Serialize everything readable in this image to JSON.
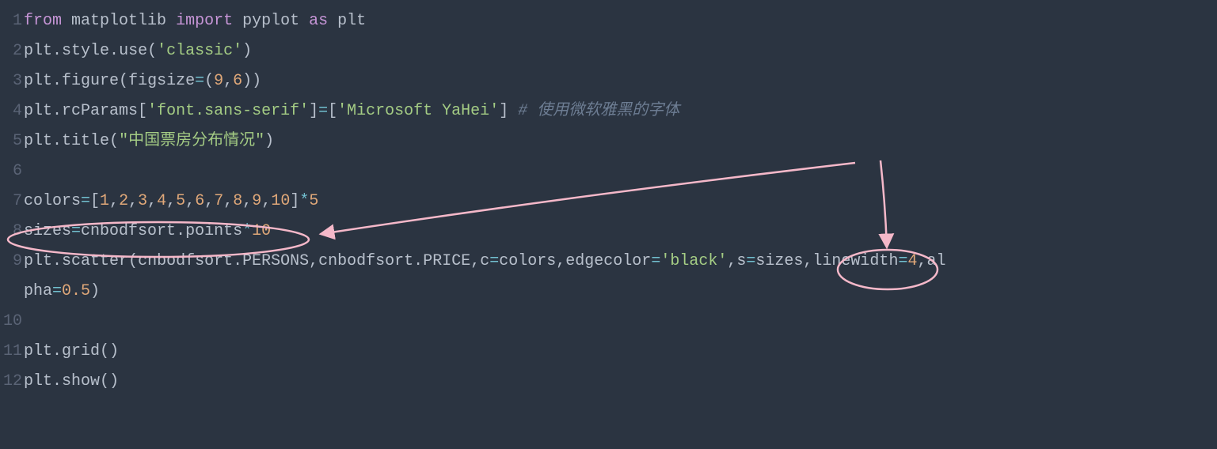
{
  "code": {
    "line1": {
      "kw_from": "from",
      "id_matplotlib": "matplotlib",
      "kw_import": "import",
      "id_pyplot": "pyplot",
      "kw_as": "as",
      "id_plt": "plt"
    },
    "line2": {
      "id_plt": "plt",
      "dot1": ".",
      "id_style": "style",
      "dot2": ".",
      "id_use": "use",
      "open": "(",
      "str_classic": "'classic'",
      "close": ")"
    },
    "line3": {
      "id_plt": "plt",
      "dot": ".",
      "id_figure": "figure",
      "open": "(",
      "id_figsize": "figsize",
      "eq": "=",
      "open2": "(",
      "num9": "9",
      "comma": ",",
      "num6": "6",
      "close2": ")",
      "close": ")"
    },
    "line4": {
      "id_plt": "plt",
      "dot": ".",
      "id_rcParams": "rcParams",
      "bopen": "[",
      "str_font": "'font.sans-serif'",
      "bclose": "]",
      "eq": "=",
      "bopen2": "[",
      "str_yahei": "'Microsoft YaHei'",
      "bclose2": "]",
      "sp": " ",
      "comment": "# 使用微软雅黑的字体"
    },
    "line5": {
      "id_plt": "plt",
      "dot": ".",
      "id_title": "title",
      "open": "(",
      "str_title": "\"中国票房分布情况\"",
      "close": ")"
    },
    "line7": {
      "id_colors": "colors",
      "eq": "=",
      "bopen": "[",
      "n1": "1",
      "c1": ",",
      "n2": "2",
      "c2": ",",
      "n3": "3",
      "c3": ",",
      "n4": "4",
      "c4": ",",
      "n5": "5",
      "c5": ",",
      "n6": "6",
      "c6": ",",
      "n7": "7",
      "c7": ",",
      "n8": "8",
      "c8": ",",
      "n9": "9",
      "c9": ",",
      "n10": "10",
      "bclose": "]",
      "mul": "*",
      "n5b": "5"
    },
    "line8": {
      "id_sizes": "sizes",
      "eq": "=",
      "id_cnbodfsort": "cnbodfsort",
      "dot": ".",
      "id_points": "points",
      "mul": "*",
      "n10": "10"
    },
    "line9": {
      "id_plt": "plt",
      "dot": ".",
      "id_scatter": "scatter",
      "open": "(",
      "id_cnbodfsort1": "cnbodfsort",
      "dot1": ".",
      "id_PERSONS": "PERSONS",
      "comma1": ",",
      "id_cnbodfsort2": "cnbodfsort",
      "dot2": ".",
      "id_PRICE": "PRICE",
      "comma2": ",",
      "id_c": "c",
      "eq1": "=",
      "id_colors": "colors",
      "comma3": ",",
      "id_edgecolor": "edgecolor",
      "eq2": "=",
      "str_black": "'black'",
      "comma4": ",",
      "id_s": "s",
      "eq3": "=",
      "id_sizes": "sizes",
      "comma5": ",",
      "id_linewidth": "linewidth",
      "eq4": "=",
      "n4": "4",
      "comma6": ",",
      "id_al": "al"
    },
    "line9b": {
      "id_pha": "pha",
      "eq": "=",
      "n05": "0.5",
      "close": ")"
    },
    "line11": {
      "id_plt": "plt",
      "dot": ".",
      "id_grid": "grid",
      "open": "(",
      "close": ")"
    },
    "line12": {
      "id_plt": "plt",
      "dot": ".",
      "id_show": "show",
      "open": "(",
      "close": ")"
    }
  },
  "annotations": {
    "ellipse_line8": {
      "color": "#f5b8c9"
    },
    "ellipse_sizes": {
      "color": "#f5b8c9"
    },
    "arrow_color": "#f5b8c9"
  },
  "linenos": {
    "l1": "1",
    "l2": "2",
    "l3": "3",
    "l4": "4",
    "l5": "5",
    "l6": "6",
    "l7": "7",
    "l8": "8",
    "l9": "9",
    "l10": "10",
    "l11": "11",
    "l12": "12"
  }
}
